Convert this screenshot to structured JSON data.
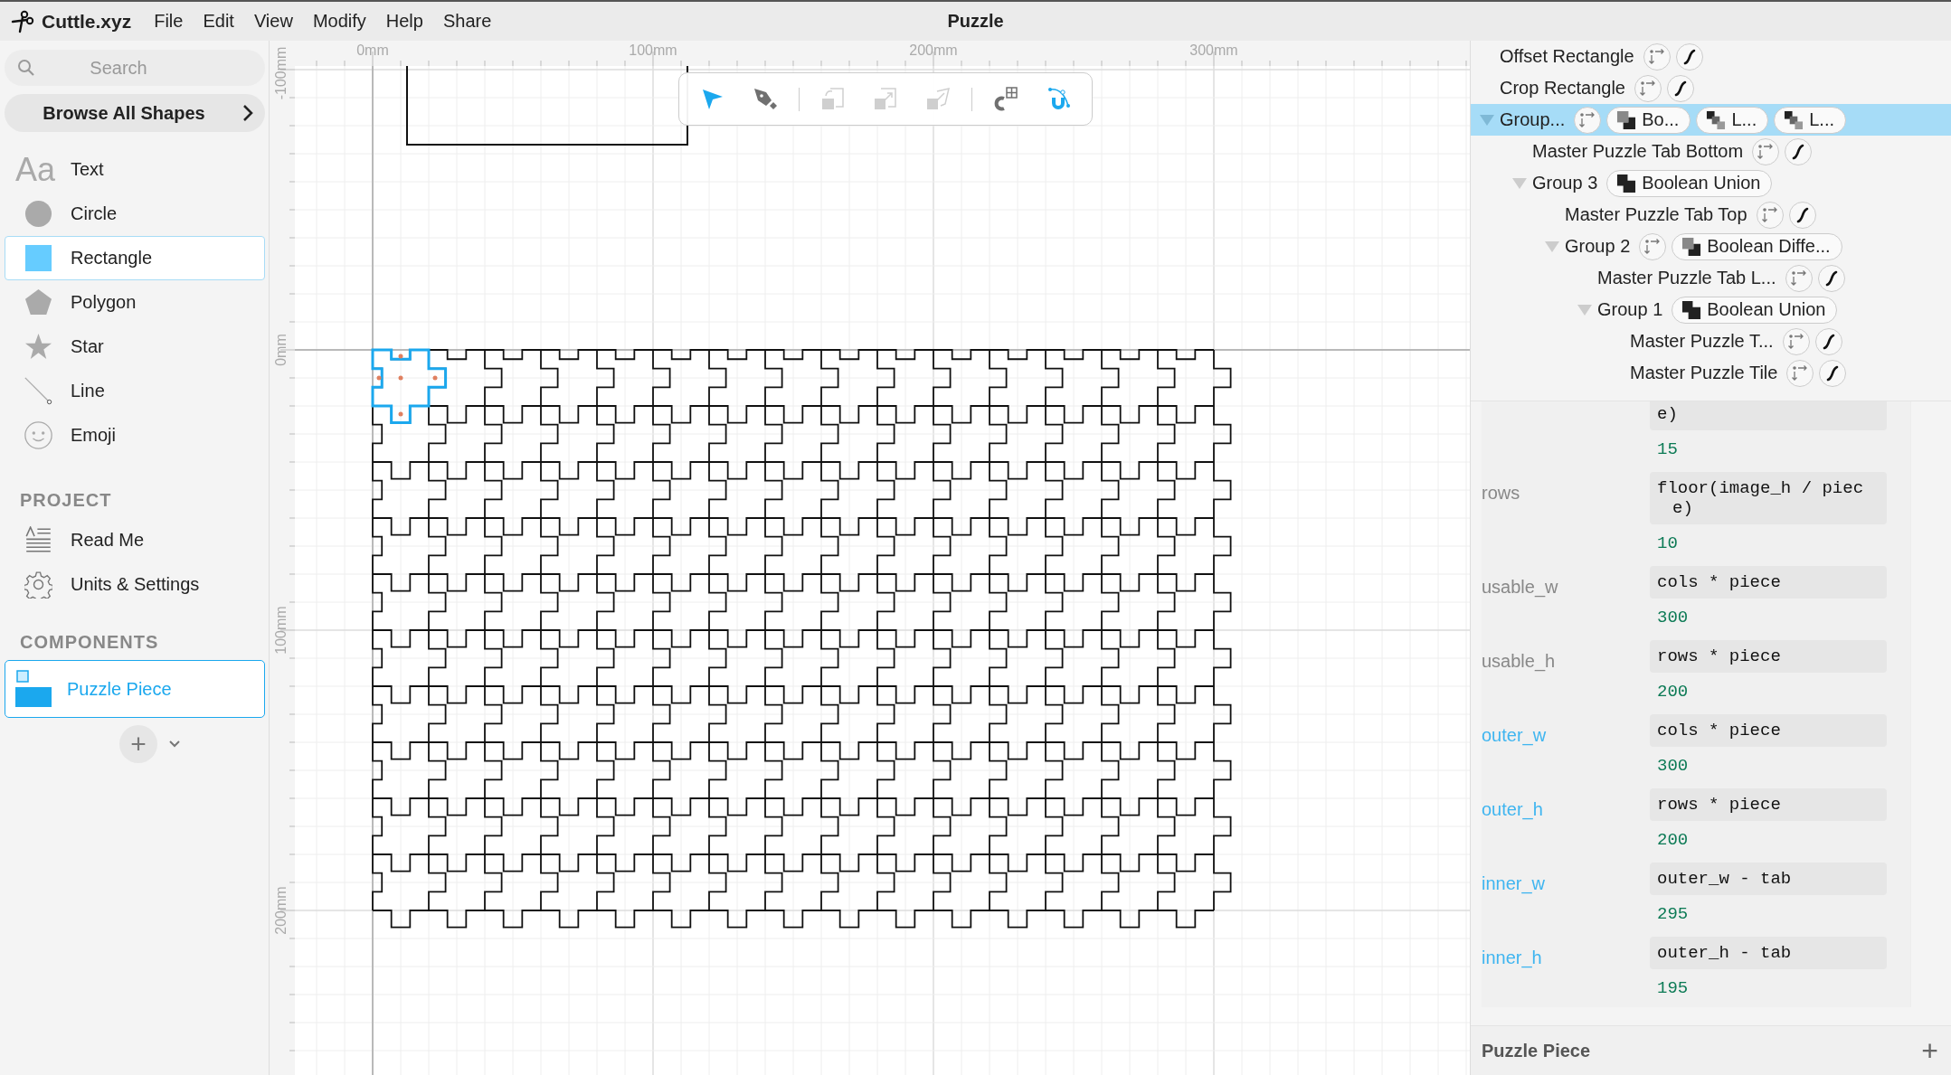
{
  "window": {
    "title": "Puzzle"
  },
  "app": {
    "name": "Cuttle.xyz"
  },
  "menu": [
    "File",
    "Edit",
    "View",
    "Modify",
    "Help",
    "Share"
  ],
  "sidebar": {
    "search": {
      "placeholder": "Search"
    },
    "browse_button": "Browse All Shapes",
    "shapes": [
      {
        "kind": "text",
        "glyph": "Aa",
        "label": "Text",
        "selected": false
      },
      {
        "kind": "circle",
        "label": "Circle",
        "selected": false
      },
      {
        "kind": "rectangle",
        "label": "Rectangle",
        "selected": true
      },
      {
        "kind": "polygon",
        "label": "Polygon",
        "selected": false
      },
      {
        "kind": "star",
        "label": "Star",
        "selected": false
      },
      {
        "kind": "line",
        "label": "Line",
        "selected": false
      },
      {
        "kind": "emoji",
        "label": "Emoji",
        "selected": false
      }
    ],
    "project_heading": "PROJECT",
    "project": [
      {
        "kind": "readme",
        "label": "Read Me"
      },
      {
        "kind": "settings",
        "label": "Units & Settings"
      }
    ],
    "components_heading": "COMPONENTS",
    "components": [
      {
        "label": "Puzzle Piece",
        "selected": true
      }
    ],
    "add_button": "+"
  },
  "canvas": {
    "rulers": {
      "top": [
        "0mm",
        "100mm",
        "200mm",
        "300mm"
      ],
      "left": [
        "-100mm",
        "0mm",
        "100mm",
        "200mm"
      ]
    },
    "toolbar": [
      [
        {
          "kind": "select",
          "selected": true,
          "disabled": false
        },
        {
          "kind": "pen",
          "selected": false,
          "disabled": false
        }
      ],
      [
        {
          "kind": "rotate",
          "selected": false,
          "disabled": true
        },
        {
          "kind": "scale",
          "selected": false,
          "disabled": true
        },
        {
          "kind": "skew",
          "selected": false,
          "disabled": true
        }
      ],
      [
        {
          "kind": "snapgrid",
          "selected": false,
          "disabled": false
        },
        {
          "kind": "snapgeometry",
          "selected": true,
          "disabled": false
        }
      ]
    ]
  },
  "tree": [
    {
      "label": "Offset Rectangle",
      "selected": false,
      "chips": [
        {
          "kind": "transform"
        },
        {
          "kind": "script"
        }
      ]
    },
    {
      "label": "Crop Rectangle",
      "selected": false,
      "chips": [
        {
          "kind": "transform"
        },
        {
          "kind": "script"
        }
      ]
    },
    {
      "label": "Group...",
      "selected": true,
      "expanded": true,
      "chips": [
        {
          "kind": "transform"
        },
        {
          "kind": "difference",
          "label": "Bo..."
        },
        {
          "kind": "layer",
          "label": "L..."
        },
        {
          "kind": "layer",
          "label": "L..."
        }
      ],
      "children": [
        {
          "label": "Master Puzzle Tab Bottom",
          "selected": false,
          "chips": [
            {
              "kind": "transform"
            },
            {
              "kind": "script"
            }
          ]
        },
        {
          "label": "Group 3",
          "selected": false,
          "expanded": true,
          "chips": [
            {
              "kind": "union",
              "label": "Boolean Union"
            }
          ],
          "children": [
            {
              "label": "Master Puzzle Tab Top",
              "selected": false,
              "chips": [
                {
                  "kind": "transform"
                },
                {
                  "kind": "script"
                }
              ]
            },
            {
              "label": "Group 2",
              "selected": false,
              "expanded": true,
              "chips": [
                {
                  "kind": "transform"
                },
                {
                  "kind": "difference",
                  "label": "Boolean Diffe..."
                }
              ],
              "children": [
                {
                  "label": "Master Puzzle Tab L...",
                  "selected": false,
                  "chips": [
                    {
                      "kind": "transform"
                    },
                    {
                      "kind": "script"
                    }
                  ]
                },
                {
                  "label": "Group 1",
                  "selected": false,
                  "expanded": true,
                  "chips": [
                    {
                      "kind": "union",
                      "label": "Boolean Union"
                    }
                  ],
                  "children": [
                    {
                      "label": "Master Puzzle T...",
                      "selected": false,
                      "chips": [
                        {
                          "kind": "transform"
                        },
                        {
                          "kind": "script"
                        }
                      ]
                    },
                    {
                      "label": "Master Puzzle Tile",
                      "selected": false,
                      "chips": [
                        {
                          "kind": "transform"
                        },
                        {
                          "kind": "script"
                        }
                      ]
                    }
                  ]
                }
              ]
            }
          ]
        }
      ]
    }
  ],
  "parameters": [
    {
      "expression": "e)",
      "value": "15"
    },
    {
      "name": "rows",
      "expression": "floor(image_h / piece)",
      "value": "10",
      "highlighted": false
    },
    {
      "name": "usable_w",
      "expression": "cols * piece",
      "value": "300",
      "highlighted": false
    },
    {
      "name": "usable_h",
      "expression": "rows * piece",
      "value": "200",
      "highlighted": false
    },
    {
      "name": "outer_w",
      "expression": "cols * piece",
      "value": "300",
      "highlighted": true
    },
    {
      "name": "outer_h",
      "expression": "rows * piece",
      "value": "200",
      "highlighted": true
    },
    {
      "name": "inner_w",
      "expression": "outer_w - tab",
      "value": "295",
      "highlighted": true
    },
    {
      "name": "inner_h",
      "expression": "outer_h - tab",
      "value": "195",
      "highlighted": true
    }
  ],
  "footer": {
    "title": "Puzzle Piece",
    "add": "+"
  }
}
